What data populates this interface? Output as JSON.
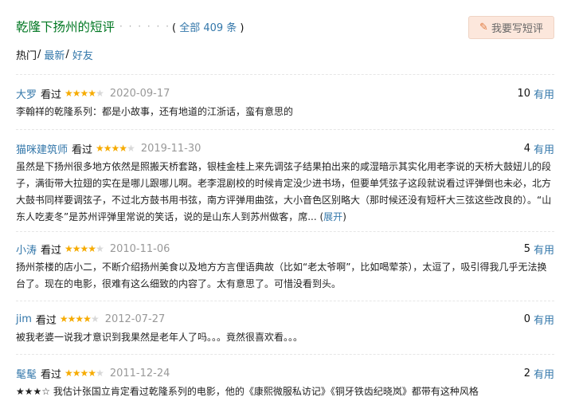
{
  "header": {
    "title": "乾隆下扬州的短评",
    "dots": "· · · · · ·",
    "count_prefix": "全部 409 条",
    "write_button": "我要写短评"
  },
  "sort": {
    "hot": "热门",
    "latest": "最新",
    "friends": "好友"
  },
  "labels": {
    "watched": "看过",
    "useful": "有用",
    "expand": "展开"
  },
  "colors": {
    "title_green": "#007722",
    "link_blue": "#3377aa",
    "star_gold": "#f6ab00",
    "button_bg": "#fce7dc"
  },
  "comments": [
    {
      "user": "大罗",
      "rating": 4,
      "date": "2020-09-17",
      "useful": "10",
      "text": "李翰祥的乾隆系列：都是小故事，还有地道的江浙话，蛮有意思的"
    },
    {
      "user": "猫咪建筑师",
      "rating": 4,
      "date": "2019-11-30",
      "useful": "4",
      "text": "虽然是下扬州很多地方依然是照搬天桥套路，银桂金桂上来先调弦子结果拍出来的咸湿暗示其实化用老李说的天桥大鼓妞儿的段子，满街带大拉翅的实在是哪儿跟哪儿啊。老李混剧校的时候肯定没少进书场，但要单凭弦子这段就说看过评弹倒也未必，北方大鼓书同样要调弦子，不过北方鼓书用书弦，南方评弹用曲弦，大小音色区别略大（那时候还没有短杆大三弦这些改良的）。“山东人吃麦冬”是苏州评弹里常说的笑话，说的是山东人到苏州做客，席..."
    },
    {
      "user": "小涛",
      "rating": 4,
      "date": "2010-11-06",
      "useful": "5",
      "text": "扬州茶楼的店小二，不断介绍扬州美食以及地方方言俚语典故（比如“老太爷啊”，比如喝荤茶），太逗了，吸引得我几乎无法换台了。现在的电影，很难有这么细致的内容了。太有意思了。可惜没看到头。"
    },
    {
      "user": "jim",
      "rating": 4,
      "date": "2012-07-27",
      "useful": "0",
      "text": "被我老婆一说我才意识到我果然是老年人了吗。。。竟然很喜欢看。。。"
    },
    {
      "user": "髦髦",
      "rating": 4,
      "date": "2011-12-24",
      "useful": "2",
      "text": "★★★☆ 我估计张国立肯定看过乾隆系列的电影，他的《康熙微服私访记》《铜牙铁齿纪晓岚》都带有这种风格"
    }
  ]
}
